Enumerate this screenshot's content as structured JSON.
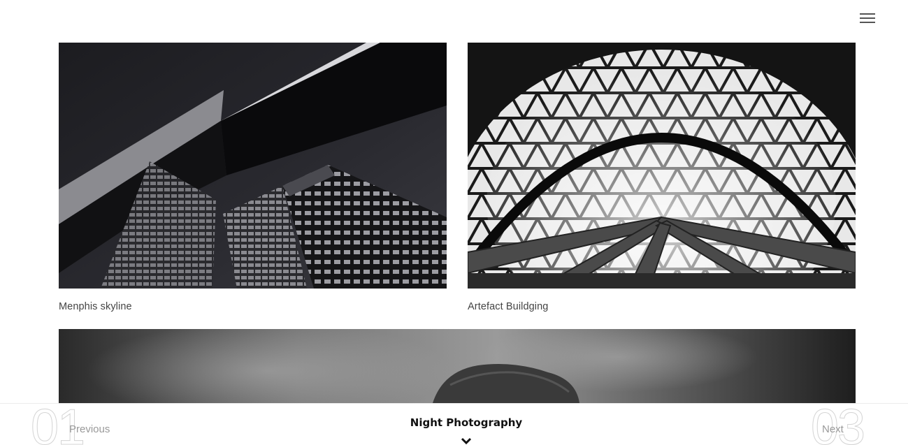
{
  "header": {
    "menu_icon": "hamburger-menu-icon"
  },
  "gallery": {
    "items": [
      {
        "caption": "Menphis skyline"
      },
      {
        "caption": "Artefact Buildging"
      },
      {
        "caption": ""
      }
    ]
  },
  "bottom_nav": {
    "prev_number": "01",
    "prev_label": "Previous",
    "title": "Night Photography",
    "next_number": "03",
    "next_label": "Next",
    "chevron_icon": "chevron-down-icon"
  },
  "colors": {
    "background": "#ffffff",
    "caption_text": "#444444",
    "nav_text": "#999999",
    "title_text": "#111111"
  }
}
